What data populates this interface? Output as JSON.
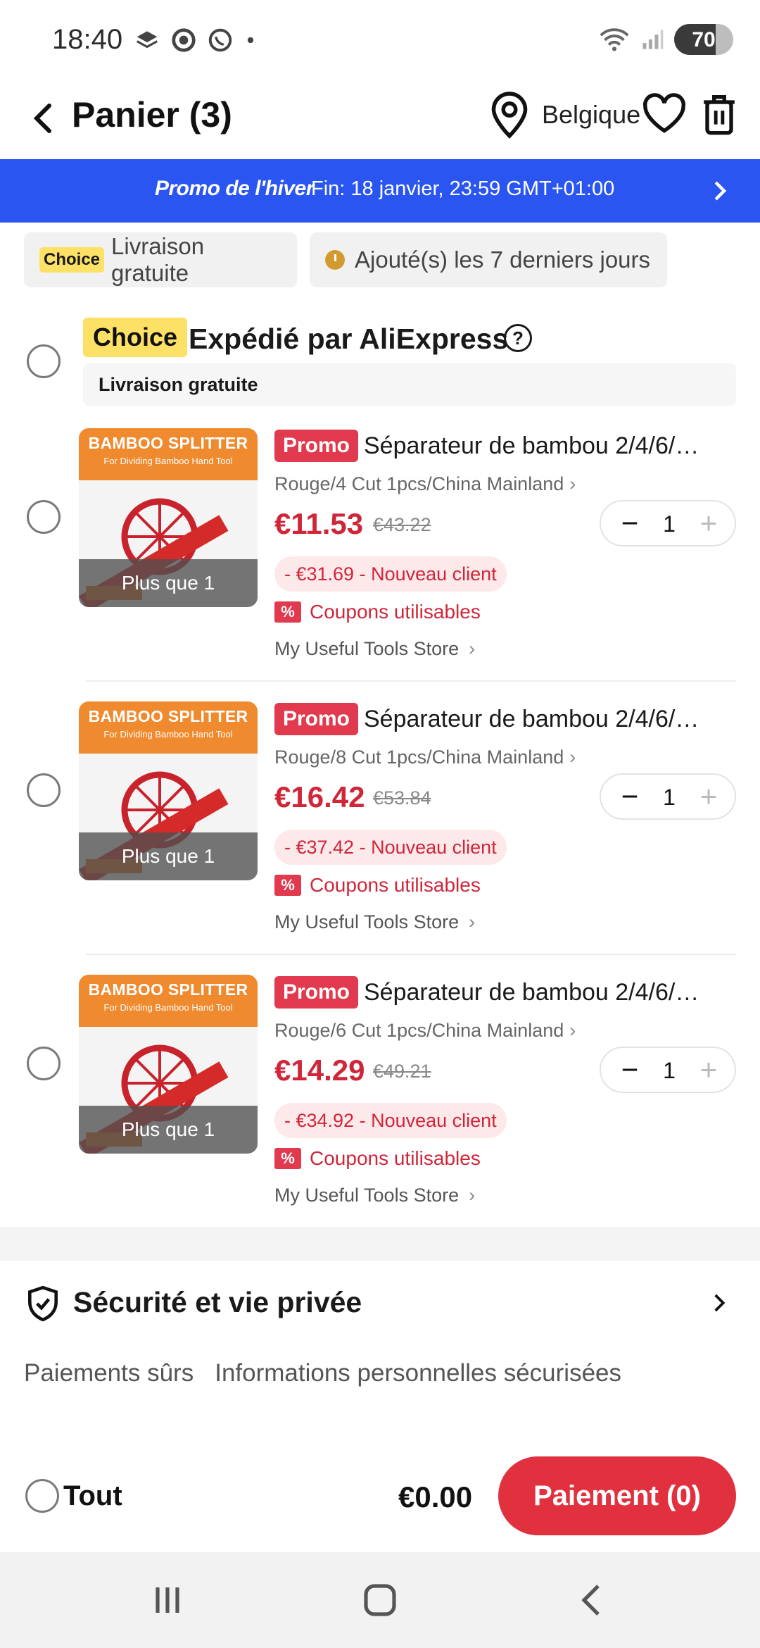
{
  "status_bar": {
    "time": "18:40",
    "battery": "70",
    "battery_level": 0.7
  },
  "header": {
    "title": "Panier (3)",
    "country": "Belgique"
  },
  "promo": {
    "title": "Promo de l'hiver",
    "deadline": "Fin: 18 janvier, 23:59 GMT+01:00"
  },
  "filters": [
    {
      "badge": "Choice",
      "label": "Livraison gratuite"
    },
    {
      "label": "Ajouté(s) les 7 derniers jours"
    }
  ],
  "seller": {
    "badge": "Choice",
    "title": "Expédié par AliExpress",
    "help": "?",
    "shipping": "Livraison gratuite"
  },
  "products": [
    {
      "tag": "Promo",
      "title": "Séparateur de bambou 2/4/6/…",
      "variant": "Rouge/4 Cut 1pcs/China Mainland",
      "price": "€11.53",
      "old_price": "€43.22",
      "quantity": "1",
      "discount": "- €31.69 - Nouveau client",
      "coupon_icon": "%",
      "coupon": "Coupons utilisables",
      "store": "My Useful Tools Store",
      "thumb_brand": "BAMBOO SPLITTER",
      "thumb_sub": "For Dividing Bamboo Hand Tool",
      "thumb_overlay": "Plus que 1"
    },
    {
      "tag": "Promo",
      "title": "Séparateur de bambou 2/4/6/…",
      "variant": "Rouge/8 Cut 1pcs/China Mainland",
      "price": "€16.42",
      "old_price": "€53.84",
      "quantity": "1",
      "discount": "- €37.42 - Nouveau client",
      "coupon_icon": "%",
      "coupon": "Coupons utilisables",
      "store": "My Useful Tools Store",
      "thumb_brand": "BAMBOO SPLITTER",
      "thumb_sub": "For Dividing Bamboo Hand Tool",
      "thumb_overlay": "Plus que 1"
    },
    {
      "tag": "Promo",
      "title": "Séparateur de bambou 2/4/6/…",
      "variant": "Rouge/6 Cut 1pcs/China Mainland",
      "price": "€14.29",
      "old_price": "€49.21",
      "quantity": "1",
      "discount": "- €34.92 - Nouveau client",
      "coupon_icon": "%",
      "coupon": "Coupons utilisables",
      "store": "My Useful Tools Store",
      "thumb_brand": "BAMBOO SPLITTER",
      "thumb_sub": "For Dividing Bamboo Hand Tool",
      "thumb_overlay": "Plus que 1"
    }
  ],
  "security": {
    "title": "Sécurité et vie privée",
    "items": [
      "Paiements sûrs",
      "Informations personnelles sécurisées"
    ]
  },
  "checkout": {
    "select_all": "Tout",
    "total": "€0.00",
    "pay_label": "Paiement (0)"
  },
  "icons": {
    "back": "chevron-left-icon",
    "location": "location-pin-icon",
    "wishlist": "heart-icon",
    "delete": "trash-icon",
    "shield": "shield-check-icon",
    "nav_recents": "recents-icon",
    "nav_home": "home-icon",
    "nav_back": "back-icon"
  },
  "colors": {
    "accent": "#e1313f",
    "promo_blue": "#2a55f0",
    "choice_yellow": "#fde167",
    "price_red": "#d0263a"
  }
}
